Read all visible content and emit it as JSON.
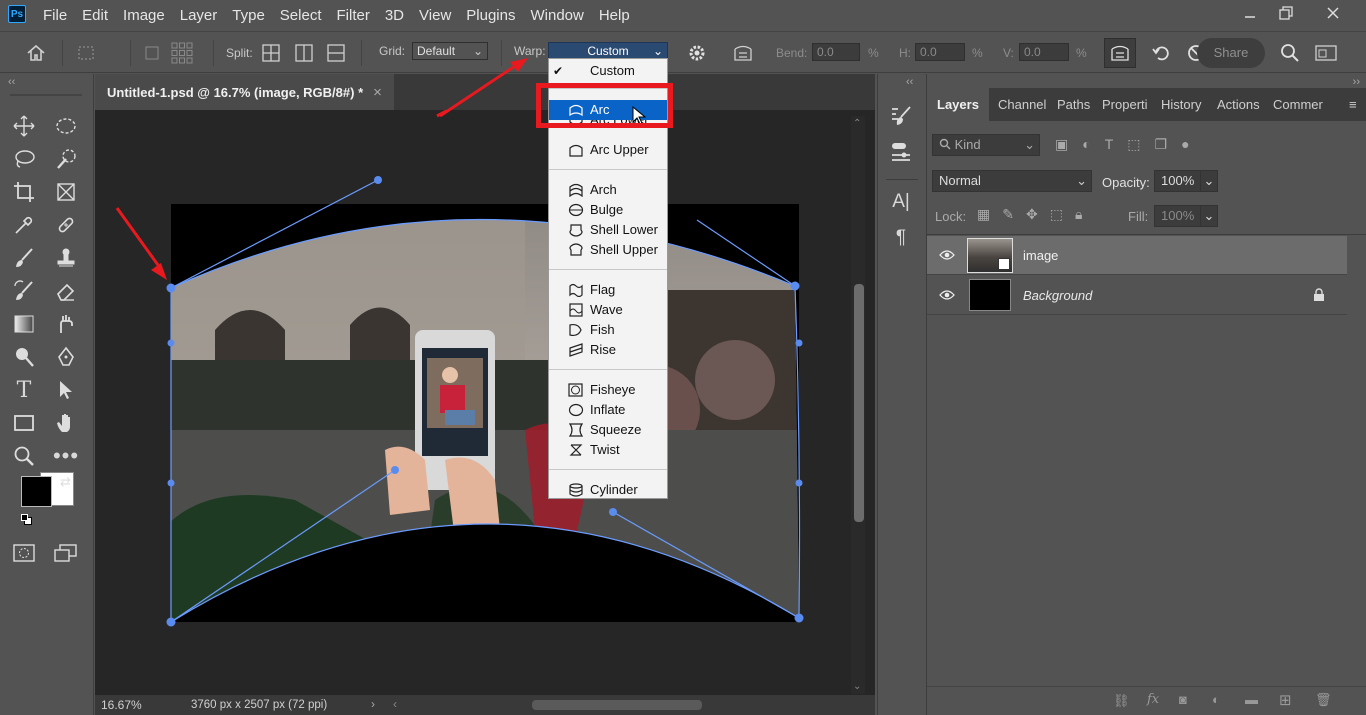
{
  "app": {
    "logo": "Ps"
  },
  "menubar": {
    "items": [
      "File",
      "Edit",
      "Image",
      "Layer",
      "Type",
      "Select",
      "Filter",
      "3D",
      "View",
      "Plugins",
      "Window",
      "Help"
    ]
  },
  "window_controls": [
    "minimize-icon",
    "restore-icon",
    "close-icon"
  ],
  "options_bar": {
    "split_label": "Split:",
    "grid_label": "Grid:",
    "grid_value": "Default",
    "warp_label": "Warp:",
    "warp_value": "Custom",
    "bend_label": "Bend:",
    "bend_value": "0.0",
    "h_label": "H:",
    "h_value": "0.0",
    "v_label": "V:",
    "v_value": "0.0",
    "percent": "%",
    "share_label": "Share"
  },
  "warp_menu": {
    "items": [
      {
        "label": "Custom",
        "checked": true
      },
      {
        "label": "Arc",
        "selected": true
      },
      {
        "label": "Arc Lower"
      },
      {
        "label": "Arc Upper"
      },
      {
        "label": "Arch"
      },
      {
        "label": "Bulge"
      },
      {
        "label": "Shell Lower"
      },
      {
        "label": "Shell Upper"
      },
      {
        "label": "Flag"
      },
      {
        "label": "Wave"
      },
      {
        "label": "Fish"
      },
      {
        "label": "Rise"
      },
      {
        "label": "Fisheye"
      },
      {
        "label": "Inflate"
      },
      {
        "label": "Squeeze"
      },
      {
        "label": "Twist"
      },
      {
        "label": "Cylinder"
      }
    ],
    "checkmark": "✔"
  },
  "document": {
    "tab_title": "Untitled-1.psd @ 16.7% (image, RGB/8#) *",
    "close_glyph": "×",
    "zoom": "16.67%",
    "size_info": "3760 px x 2507 px (72 ppi)"
  },
  "layers_panel": {
    "tabs": [
      "Layers",
      "Channel",
      "Paths",
      "Properti",
      "History",
      "Actions",
      "Commer"
    ],
    "kind_label": "Kind",
    "blend_mode": "Normal",
    "opacity_label": "Opacity:",
    "opacity_value": "100%",
    "lock_label": "Lock:",
    "fill_label": "Fill:",
    "fill_value": "100%",
    "layers": [
      {
        "name": "image",
        "selected": true
      },
      {
        "name": "Background",
        "locked": true
      }
    ]
  }
}
